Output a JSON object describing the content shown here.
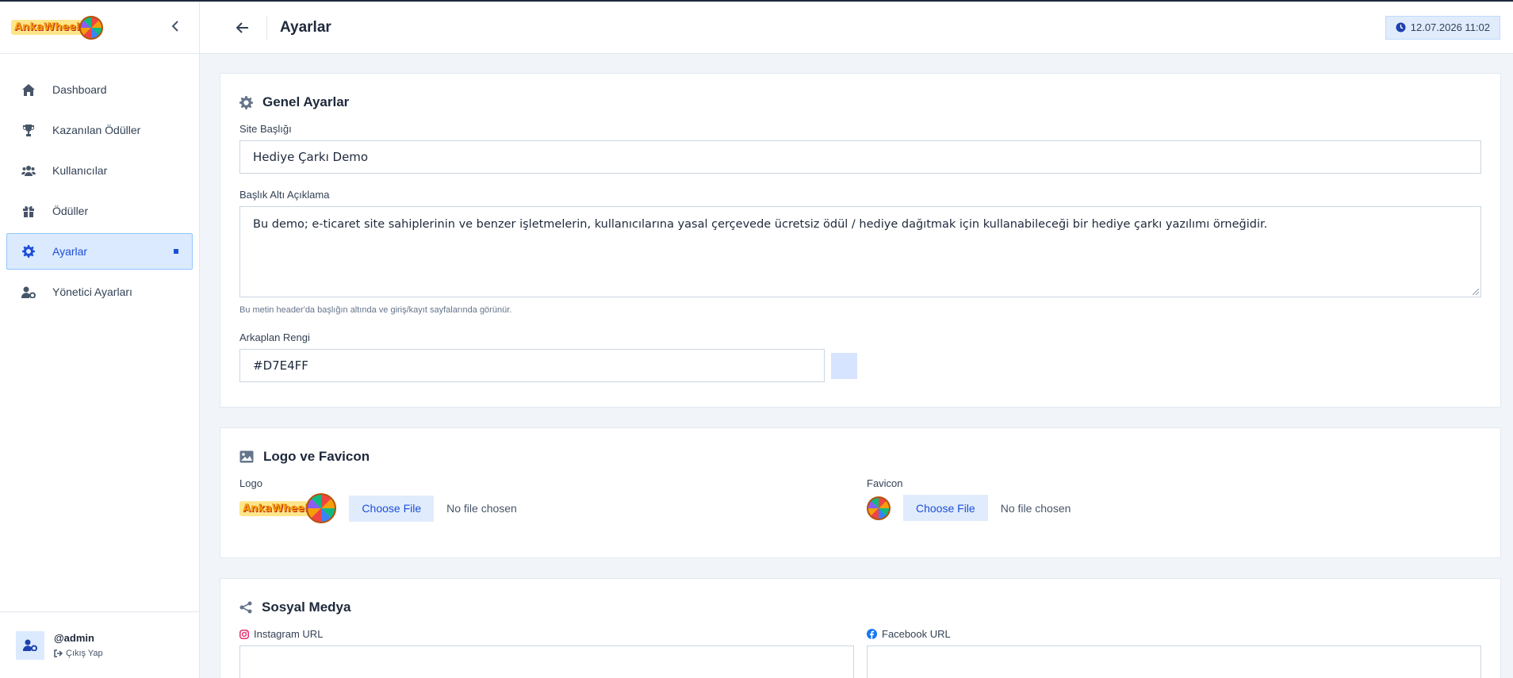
{
  "sidebar": {
    "logo_text": "AnkaWheel",
    "items": [
      {
        "label": "Dashboard"
      },
      {
        "label": "Kazanılan Ödüller"
      },
      {
        "label": "Kullanıcılar"
      },
      {
        "label": "Ödüller"
      },
      {
        "label": "Ayarlar"
      },
      {
        "label": "Yönetici Ayarları"
      }
    ],
    "user": {
      "name": "@admin",
      "logout_label": "Çıkış Yap"
    }
  },
  "header": {
    "title": "Ayarlar",
    "datetime": "12.07.2026 11:02"
  },
  "general": {
    "title": "Genel Ayarlar",
    "site_title_label": "Site Başlığı",
    "site_title_value": "Hediye Çarkı Demo",
    "subtitle_label": "Başlık Altı Açıklama",
    "subtitle_value": "Bu demo; e-ticaret site sahiplerinin ve benzer işletmelerin, kullanıcılarına yasal çerçevede ücretsiz ödül / hediye dağıtmak için kullanabileceği bir hediye çarkı yazılımı örneğidir.",
    "subtitle_hint": "Bu metin header'da başlığın altında ve giriş/kayıt sayfalarında görünür.",
    "bg_color_label": "Arkaplan Rengi",
    "bg_color_value": "#D7E4FF"
  },
  "logo_favicon": {
    "title": "Logo ve Favicon",
    "logo_label": "Logo",
    "favicon_label": "Favicon",
    "choose_file_label": "Choose File",
    "no_file_label": "No file chosen"
  },
  "social": {
    "title": "Sosyal Medya",
    "instagram_label": "Instagram URL",
    "facebook_label": "Facebook URL"
  },
  "colors": {
    "accent": "#1d4ed8",
    "active_bg": "#dbeafe",
    "swatch": "#D7E4FF"
  }
}
